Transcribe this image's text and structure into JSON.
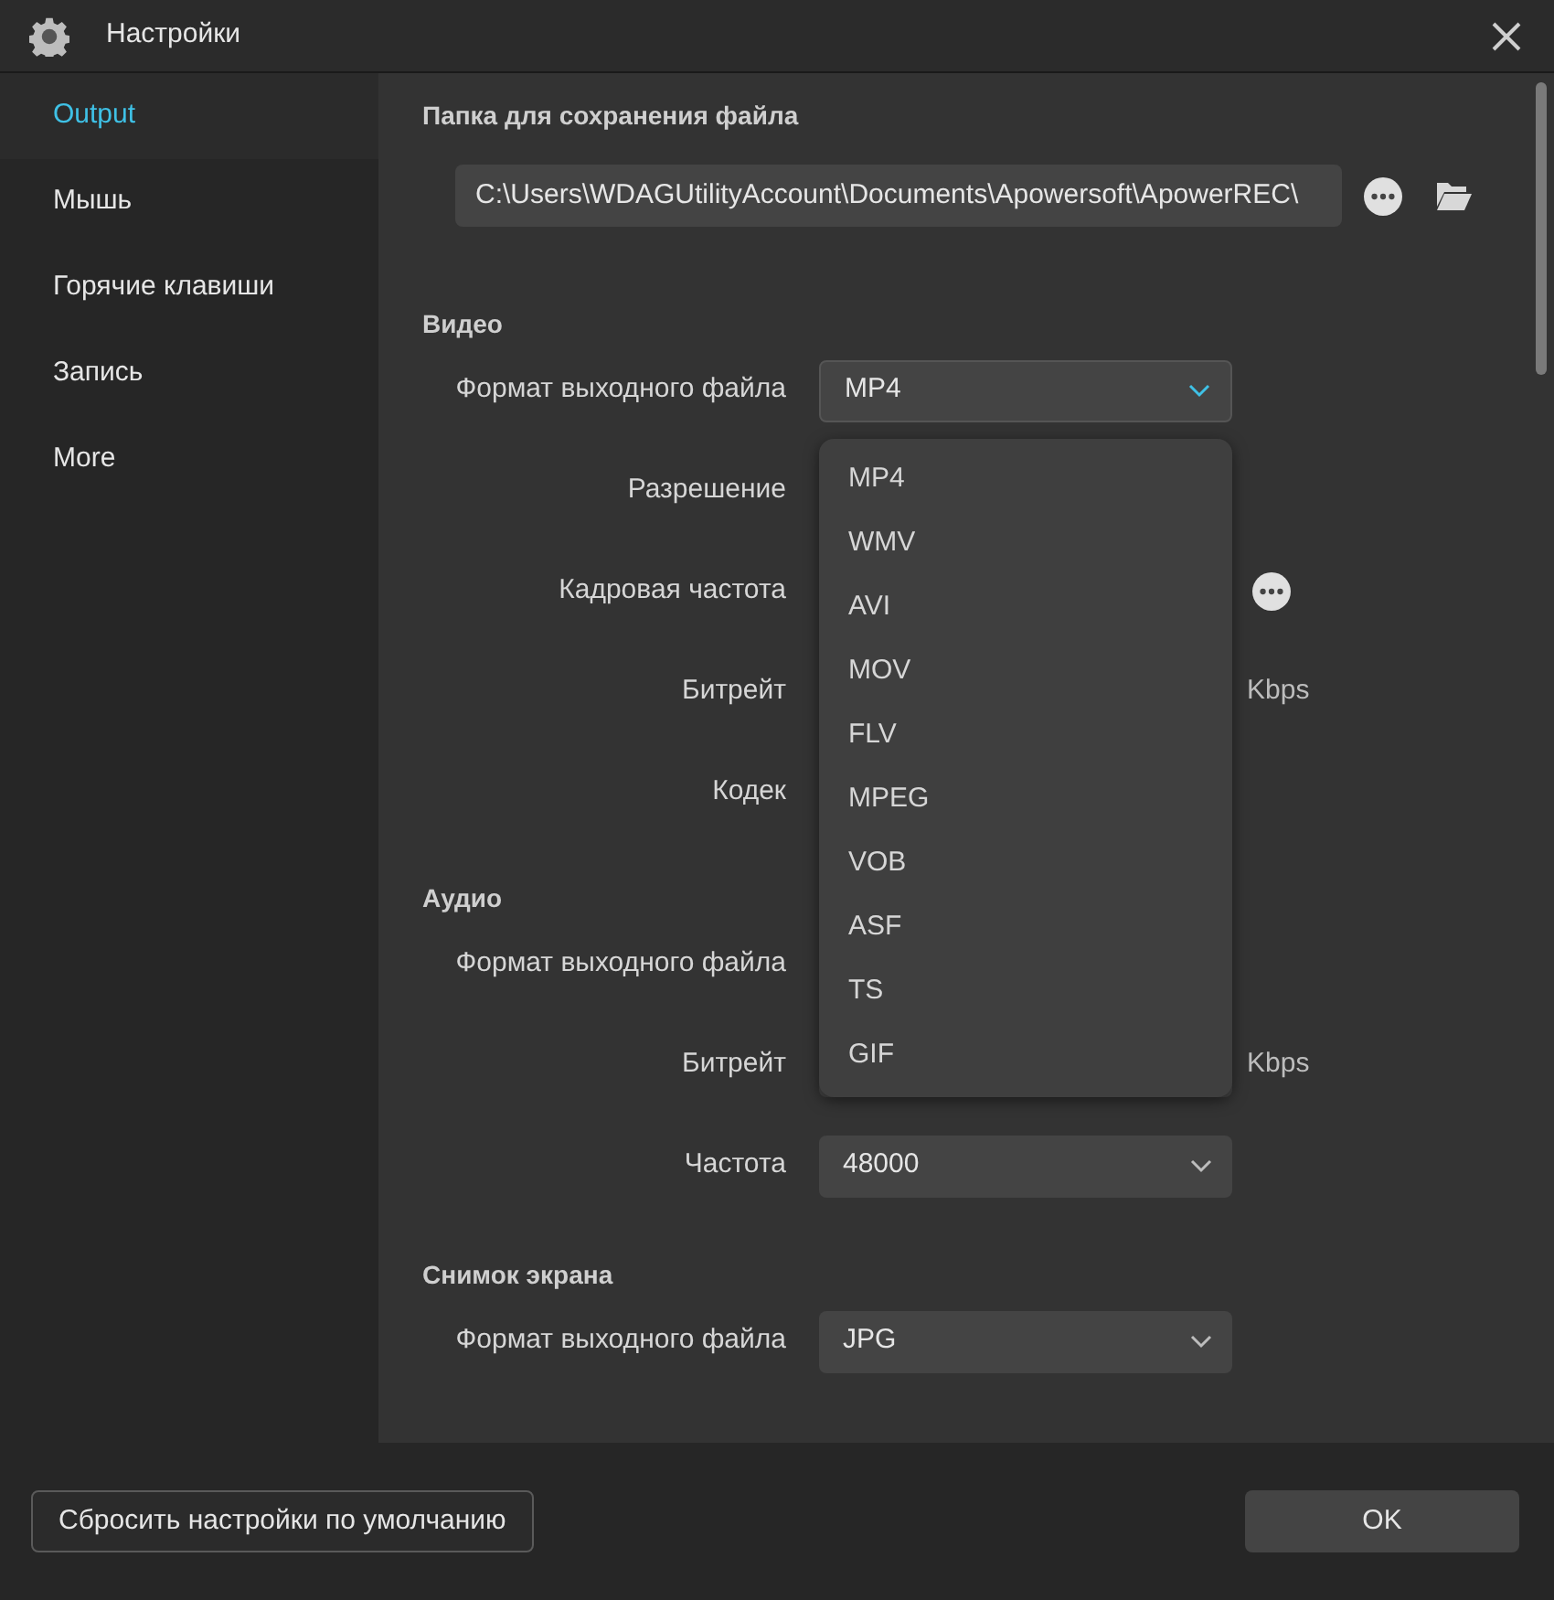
{
  "window": {
    "title": "Настройки"
  },
  "sidebar": {
    "items": [
      {
        "label": "Output",
        "selected": true
      },
      {
        "label": "Мышь",
        "selected": false
      },
      {
        "label": "Горячие клавиши",
        "selected": false
      },
      {
        "label": "Запись",
        "selected": false
      },
      {
        "label": "More",
        "selected": false
      }
    ]
  },
  "folder": {
    "title": "Папка для сохранения файла",
    "path": "C:\\Users\\WDAGUtilityAccount\\Documents\\Apowersoft\\ApowerREC\\"
  },
  "sections": [
    {
      "title": "Видео",
      "rows": [
        {
          "label": "Формат выходного файла",
          "value": "MP4",
          "open": true
        },
        {
          "label": "Разрешение"
        },
        {
          "label": "Кадровая частота",
          "more_button": true
        },
        {
          "label": "Битрейт",
          "unit": "Kbps"
        },
        {
          "label": "Кодек"
        }
      ]
    },
    {
      "title": "Аудио",
      "rows": [
        {
          "label": "Формат выходного файла"
        },
        {
          "label": "Битрейт",
          "unit": "Kbps"
        },
        {
          "label": "Частота",
          "value": "48000"
        }
      ]
    },
    {
      "title": "Снимок экрана",
      "rows": [
        {
          "label": "Формат выходного файла",
          "value": "JPG"
        }
      ]
    }
  ],
  "dropdown": {
    "items": [
      "MP4",
      "WMV",
      "AVI",
      "MOV",
      "FLV",
      "MPEG",
      "VOB",
      "ASF",
      "TS",
      "GIF"
    ]
  },
  "buttons": {
    "reset": "Сбросить настройки по умолчанию",
    "ok": "OK"
  }
}
